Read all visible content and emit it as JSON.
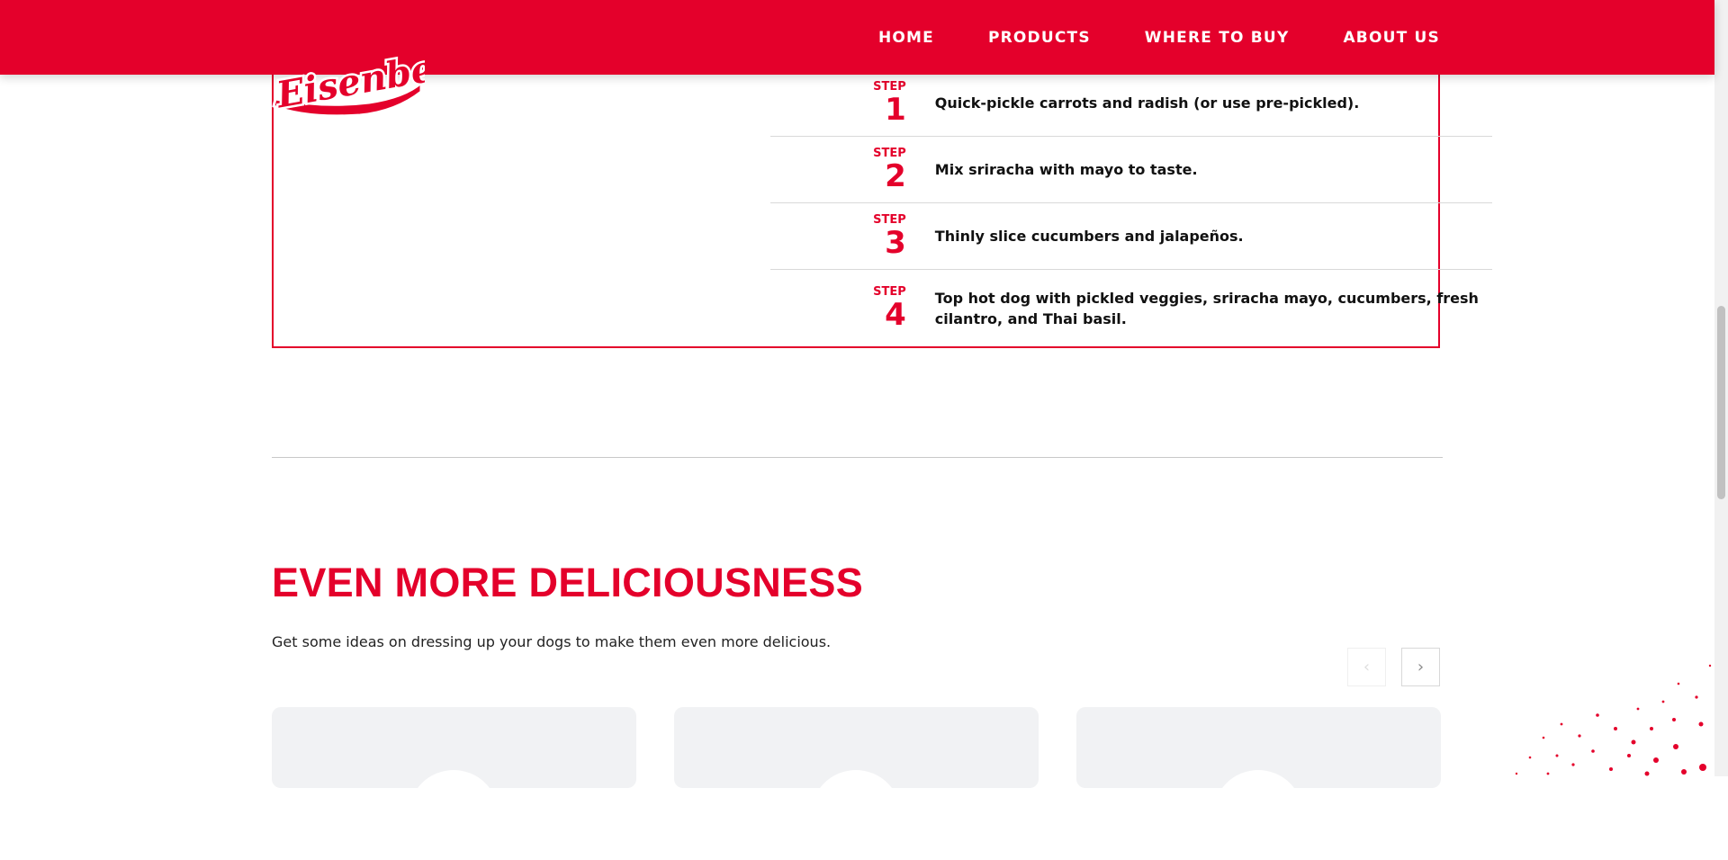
{
  "brand": {
    "logo_text": "Eisenberg"
  },
  "nav": {
    "items": [
      "HOME",
      "PRODUCTS",
      "WHERE TO BUY",
      "ABOUT US"
    ]
  },
  "steps": {
    "label": "STEP",
    "items": [
      {
        "number": "1",
        "text": "Quick-pickle carrots and radish (or use pre-pickled)."
      },
      {
        "number": "2",
        "text": "Mix sriracha with mayo to taste."
      },
      {
        "number": "3",
        "text": "Thinly slice cucumbers and jalapeños."
      },
      {
        "number": "4",
        "text": "Top hot dog with pickled veggies, sriracha mayo, cucumbers, fresh cilantro, and Thai basil."
      }
    ]
  },
  "more": {
    "title": "EVEN MORE DELICIOUSNESS",
    "subtitle": "Get some ideas on dressing up your dogs to make them even more delicious.",
    "prev_icon": "chevron-left-icon",
    "next_icon": "chevron-right-icon"
  },
  "colors": {
    "brand_red": "#e4002b",
    "card_bg": "#f1f2f4"
  }
}
